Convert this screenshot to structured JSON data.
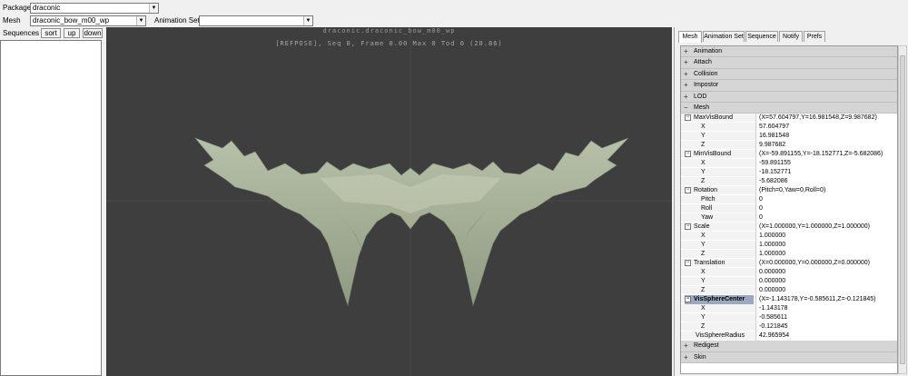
{
  "toolbar": {
    "package_label": "Package",
    "package_value": "draconic",
    "mesh_label": "Mesh",
    "mesh_value": "draconic_bow_m00_wp",
    "animset_label": "Animation Set",
    "animset_value": ""
  },
  "sequences": {
    "label": "Sequences",
    "sort": "sort",
    "up": "up",
    "down": "down"
  },
  "viewport": {
    "title": "draconic.draconic_bow_m00_wp",
    "stats": "[REFPOSE], Seq 0,  Frame  0.00 Max 0  Tod 0 (20.86)"
  },
  "tabs": [
    "Mesh",
    "Animation Set",
    "Sequence",
    "Notify",
    "Prefs"
  ],
  "props": {
    "animation": "Animation",
    "attach": "Attach",
    "collision": "Collision",
    "impostor": "Impostor",
    "lod": "LOD",
    "mesh": "Mesh",
    "maxvis": {
      "name": "MaxVisBound",
      "value": "(X=57.604797,Y=16.981548,Z=9.987682)",
      "x": "57.604797",
      "y": "16.981548",
      "z": "9.987682"
    },
    "minvis": {
      "name": "MinVisBound",
      "value": "(X=-59.891155,Y=-18.152771,Z=-5.682086)",
      "x": "-59.891155",
      "y": "-18.152771",
      "z": "-5.682086"
    },
    "rotation": {
      "name": "Rotation",
      "value": "(Pitch=0,Yaw=0,Roll=0)",
      "pitch_label": "Pitch",
      "pitch": "0",
      "roll_label": "Roll",
      "roll": "0",
      "yaw_label": "Yaw",
      "yaw": "0"
    },
    "scale": {
      "name": "Scale",
      "value": "(X=1.000000,Y=1.000000,Z=1.000000)",
      "x": "1.000000",
      "y": "1.000000",
      "z": "1.000000"
    },
    "translation": {
      "name": "Translation",
      "value": "(X=0.000000,Y=0.000000,Z=0.000000)",
      "x": "0.000000",
      "y": "0.000000",
      "z": "0.000000"
    },
    "vissphere": {
      "name": "VisSphereCenter",
      "value": "(X=-1.143178,Y=-0.585611,Z=-0.121845)",
      "x": "-1.143178",
      "y": "-0.585611",
      "z": "-0.121845"
    },
    "radius": {
      "name": "VisSphereRadius",
      "value": "42.965954"
    },
    "x_label": "X",
    "y_label": "Y",
    "z_label": "Z",
    "redigest": "Redigest",
    "skin": "Skin"
  },
  "colors": {
    "viewport_bg": "#3e3e3e",
    "mesh_fill": "#a9b39a"
  }
}
